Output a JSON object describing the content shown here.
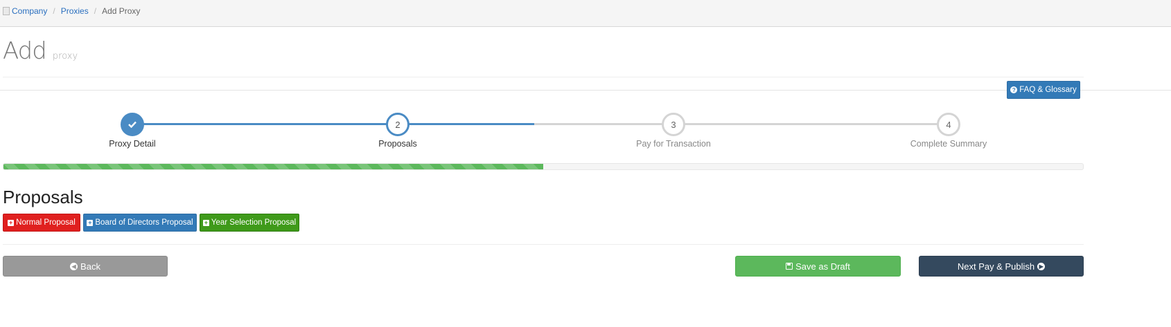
{
  "breadcrumb": {
    "items": [
      {
        "label": "Company"
      },
      {
        "label": "Proxies"
      }
    ],
    "separator": "/",
    "current": "Add Proxy"
  },
  "page": {
    "title": "Add",
    "subtitle": "proxy"
  },
  "faq": {
    "icon": "question-circle-icon",
    "label": "FAQ & Glossary"
  },
  "wizard": {
    "steps": [
      {
        "number": "1",
        "label": "Proxy Detail",
        "state": "done",
        "icon": "check-icon"
      },
      {
        "number": "2",
        "label": "Proposals",
        "state": "active"
      },
      {
        "number": "3",
        "label": "Pay for Transaction",
        "state": "todo"
      },
      {
        "number": "4",
        "label": "Complete Summary",
        "state": "todo"
      }
    ],
    "progress_percent": 50
  },
  "proposals": {
    "title": "Proposals",
    "buttons": [
      {
        "label": "Normal Proposal",
        "color": "#e0201f",
        "icon": "plus-square-icon"
      },
      {
        "label": "Board of Directors Proposal",
        "color": "#337ab7",
        "icon": "plus-square-icon"
      },
      {
        "label": "Year Selection Proposal",
        "color": "#3f9a1a",
        "icon": "plus-square-icon"
      }
    ]
  },
  "footer": {
    "back_label": "Back",
    "back_icon": "arrow-circle-left-icon",
    "save_label": "Save as Draft",
    "save_icon": "floppy-disk-icon",
    "next_label": "Next Pay & Publish",
    "next_icon": "arrow-circle-right-icon"
  },
  "colors": {
    "primary": "#337ab7",
    "success": "#5cb85c",
    "danger": "#e0201f",
    "dark": "#34495e",
    "muted": "#999999"
  }
}
